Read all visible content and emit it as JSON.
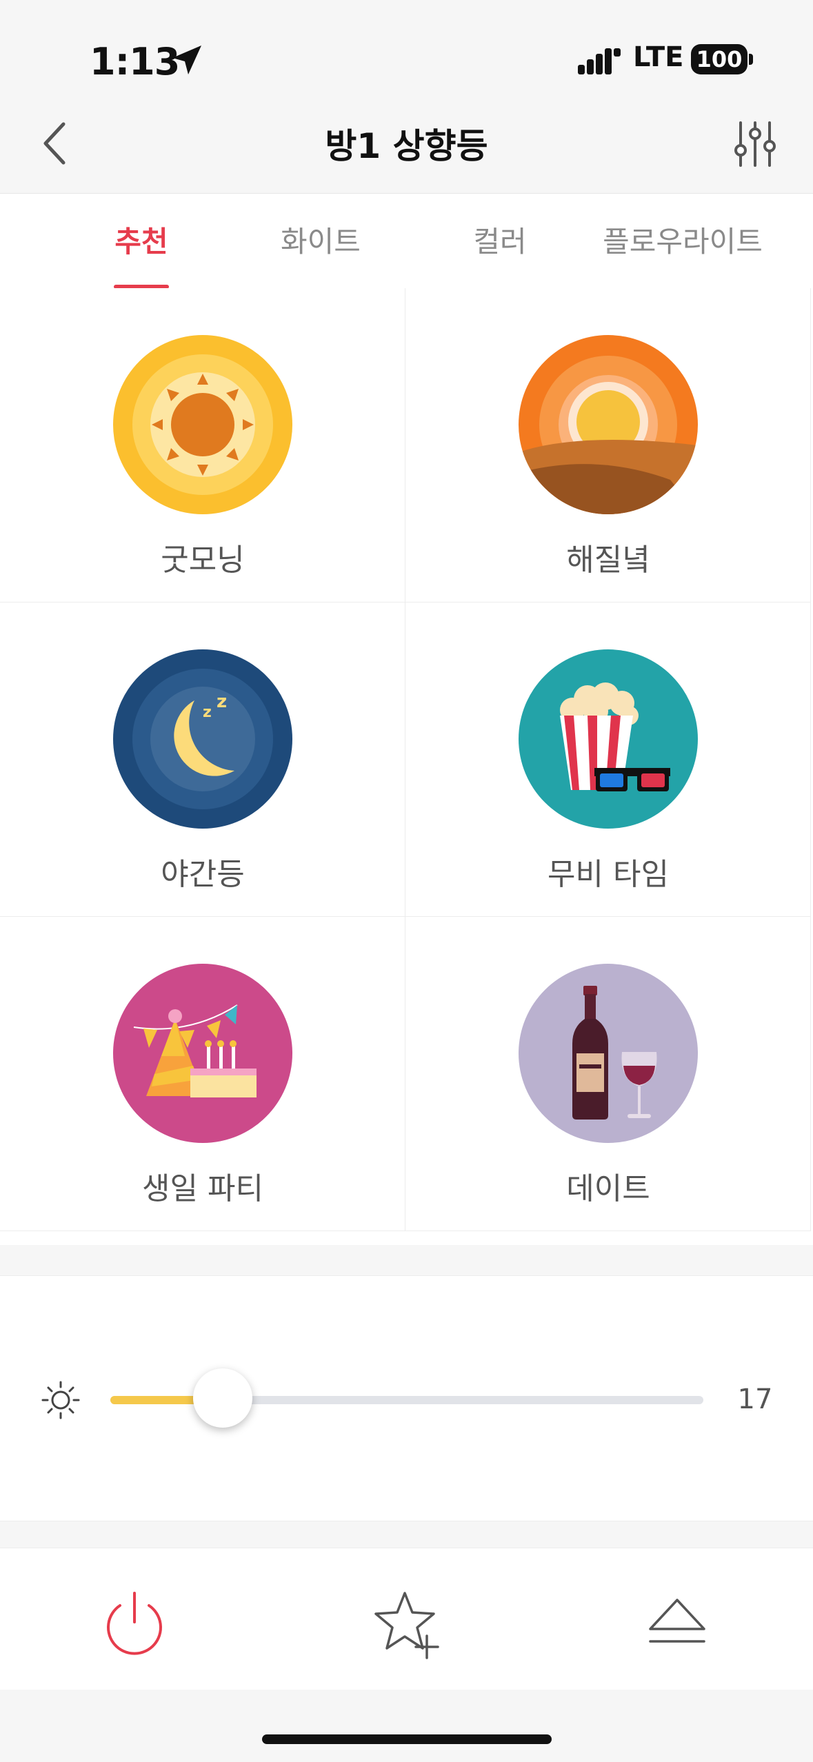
{
  "status_bar": {
    "time": "1:13",
    "network": "LTE",
    "battery": "100"
  },
  "header": {
    "title": "방1 상향등"
  },
  "tabs": [
    {
      "label": "추천",
      "active": true
    },
    {
      "label": "화이트",
      "active": false
    },
    {
      "label": "컬러",
      "active": false
    },
    {
      "label": "플로우라이트",
      "active": false
    }
  ],
  "scenes": [
    {
      "label": "굿모닝",
      "icon": "sun-icon"
    },
    {
      "label": "해질녘",
      "icon": "sunset-icon"
    },
    {
      "label": "야간등",
      "icon": "moon-icon"
    },
    {
      "label": "무비 타임",
      "icon": "popcorn-icon"
    },
    {
      "label": "생일 파티",
      "icon": "party-icon"
    },
    {
      "label": "데이트",
      "icon": "wine-icon"
    }
  ],
  "brightness": {
    "value": "17",
    "fraction": 0.19
  },
  "colors": {
    "accent": "#e63c4c",
    "slider_fill": "#f5c84b"
  }
}
